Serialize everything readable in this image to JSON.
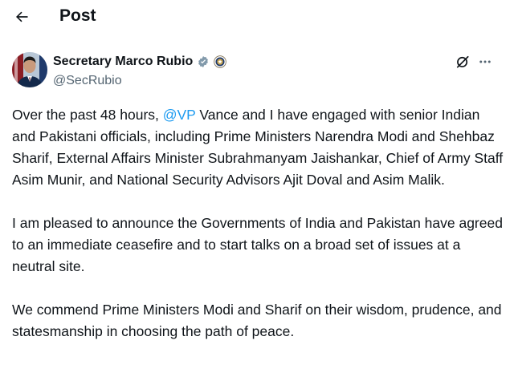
{
  "header": {
    "title": "Post",
    "back_icon": "arrow-left-icon"
  },
  "author": {
    "name": "Secretary Marco Rubio",
    "handle": "@SecRubio",
    "verified_badge": "gray-checkmark-badge-icon",
    "affiliation_badge": "us-state-department-seal-icon"
  },
  "actions": {
    "grok_icon": "grok-icon",
    "more_icon": "more-horizontal-icon"
  },
  "post": {
    "p1_before": "Over the past 48 hours, ",
    "p1_mention": "@VP",
    "p1_after": " Vance and I have engaged with senior Indian and Pakistani officials, including Prime Ministers Narendra Modi and Shehbaz Sharif, External Affairs Minister Subrahmanyam Jaishankar, Chief of Army Staff Asim Munir, and National Security Advisors Ajit Doval and Asim Malik.",
    "p2": "I am pleased to announce the Governments of India and Pakistan have agreed to an immediate ceasefire and to start talks on a broad set of issues at a neutral site.",
    "p3": "We commend Prime Ministers Modi and Sharif on their wisdom, prudence, and statesmanship in choosing the path of peace."
  },
  "colors": {
    "text": "#0f1419",
    "secondary_text": "#536471",
    "mention": "#1d9bf0",
    "verified_badge": "#829aab"
  }
}
